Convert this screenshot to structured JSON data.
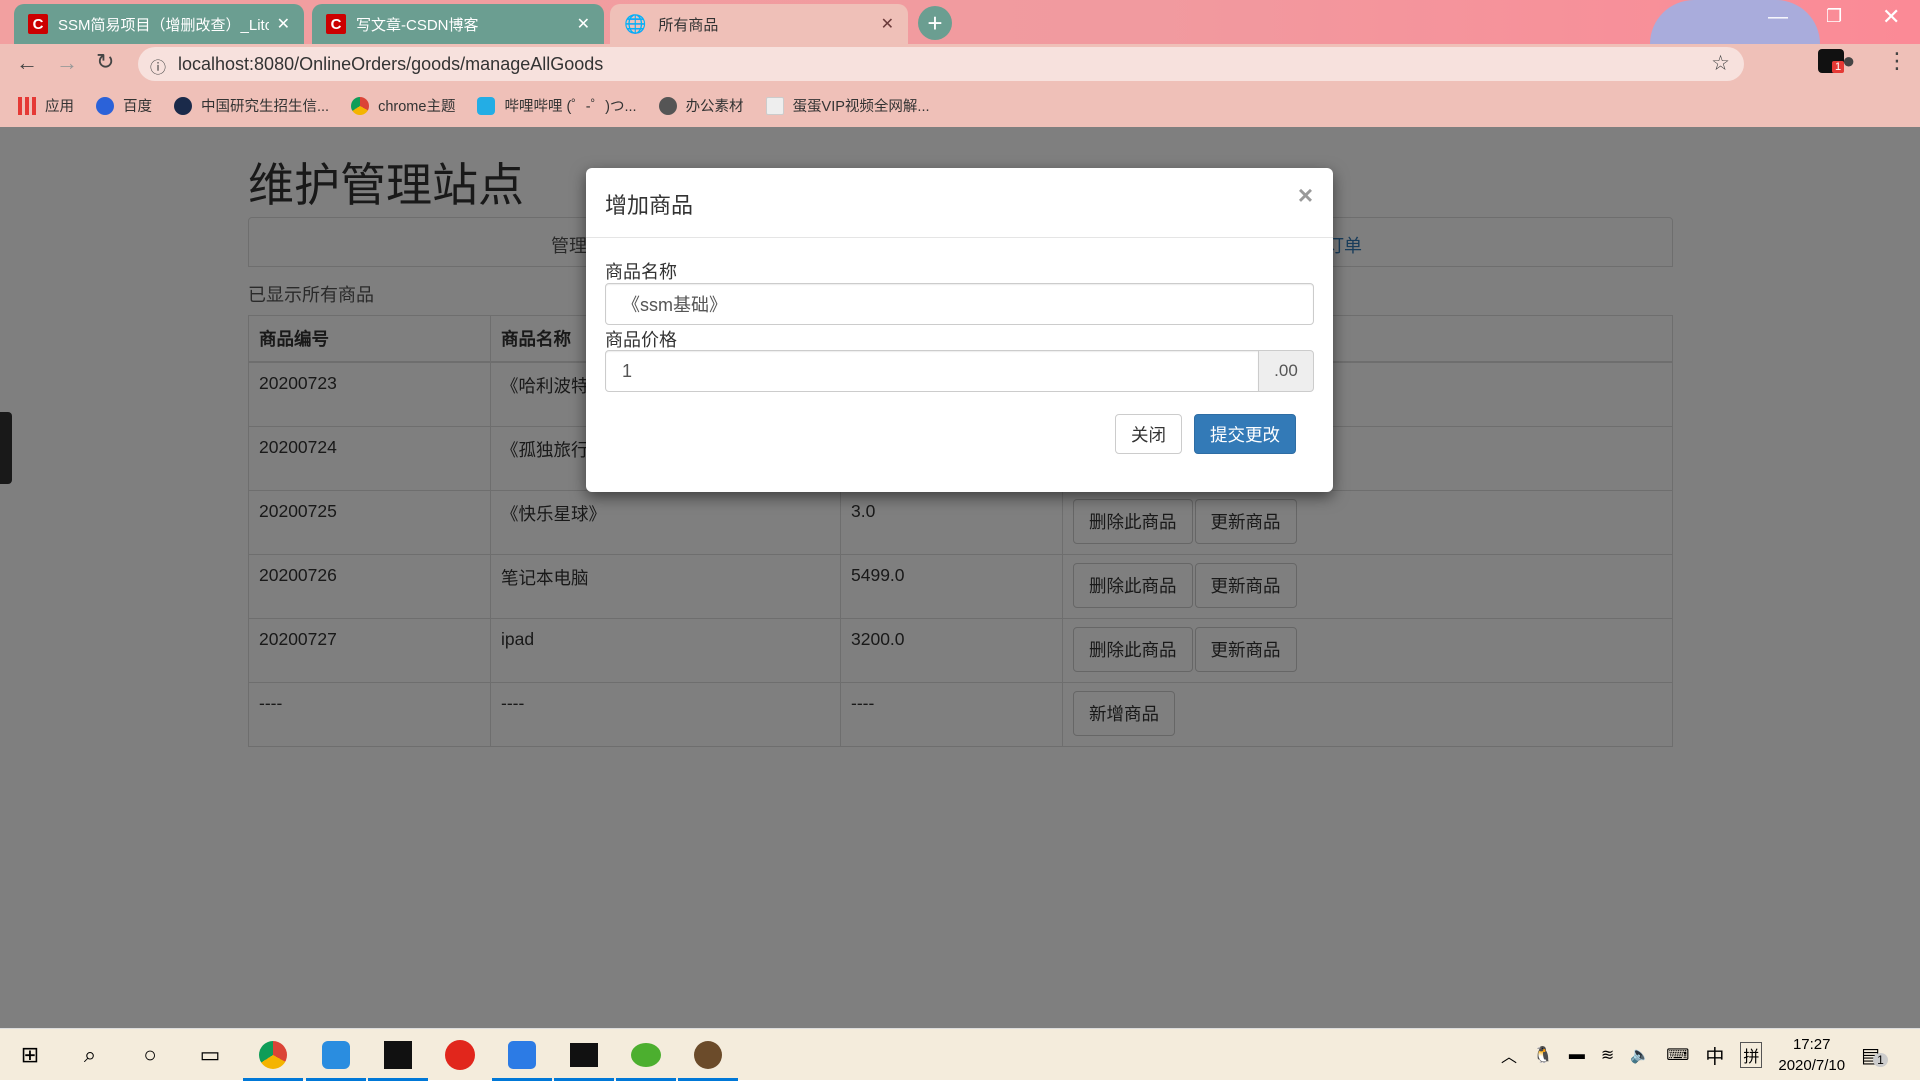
{
  "browser": {
    "tabs": [
      {
        "title": "SSM简易项目（增删改查）_Lito",
        "icon": "csdn-icon"
      },
      {
        "title": "写文章-CSDN博客",
        "icon": "csdn-icon"
      },
      {
        "title": "所有商品",
        "icon": "globe-icon"
      }
    ],
    "url": "localhost:8080/OnlineOrders/goods/manageAllGoods",
    "extension_badge": "1",
    "bookmarks": [
      {
        "label": "应用",
        "icon": "apps-grid-icon"
      },
      {
        "label": "百度",
        "icon": "baidu-icon"
      },
      {
        "label": "中国研究生招生信...",
        "icon": "graduation-cap-icon"
      },
      {
        "label": "chrome主题",
        "icon": "chrome-icon"
      },
      {
        "label": "哔哩哔哩 (゜-゜)つ...",
        "icon": "bilibili-icon"
      },
      {
        "label": "办公素材",
        "icon": "globe-icon"
      },
      {
        "label": "蛋蛋VIP视频全网解...",
        "icon": "video-icon"
      }
    ]
  },
  "page": {
    "title": "维护管理站点",
    "nav": {
      "left_fragment": "管理",
      "right_fragment": "订单"
    },
    "status": "已显示所有商品",
    "table": {
      "headers": [
        "商品编号",
        "商品名称"
      ],
      "rows": [
        {
          "id": "20200723",
          "name": "《哈利波特",
          "price": "",
          "actions": []
        },
        {
          "id": "20200724",
          "name": "《孤独旅行",
          "price": "",
          "actions": []
        },
        {
          "id": "20200725",
          "name": "《快乐星球》",
          "price": "3.0",
          "actions": [
            "删除此商品",
            "更新商品"
          ]
        },
        {
          "id": "20200726",
          "name": "笔记本电脑",
          "price": "5499.0",
          "actions": [
            "删除此商品",
            "更新商品"
          ]
        },
        {
          "id": "20200727",
          "name": "ipad",
          "price": "3200.0",
          "actions": [
            "删除此商品",
            "更新商品"
          ]
        },
        {
          "id": "----",
          "name": "----",
          "price": "----",
          "actions": [
            "新增商品"
          ]
        }
      ]
    }
  },
  "modal": {
    "title": "增加商品",
    "close_symbol": "×",
    "name_label": "商品名称",
    "name_value": "《ssm基础》",
    "price_label": "商品价格",
    "price_value": "1",
    "price_suffix": ".00",
    "close_button": "关闭",
    "submit_button": "提交更改",
    "primary_color": "#337ab7"
  },
  "taskbar": {
    "time": "17:27",
    "date": "2020/7/10",
    "ime_mode": "中",
    "ime_name": "拼",
    "notification_count": "1"
  }
}
